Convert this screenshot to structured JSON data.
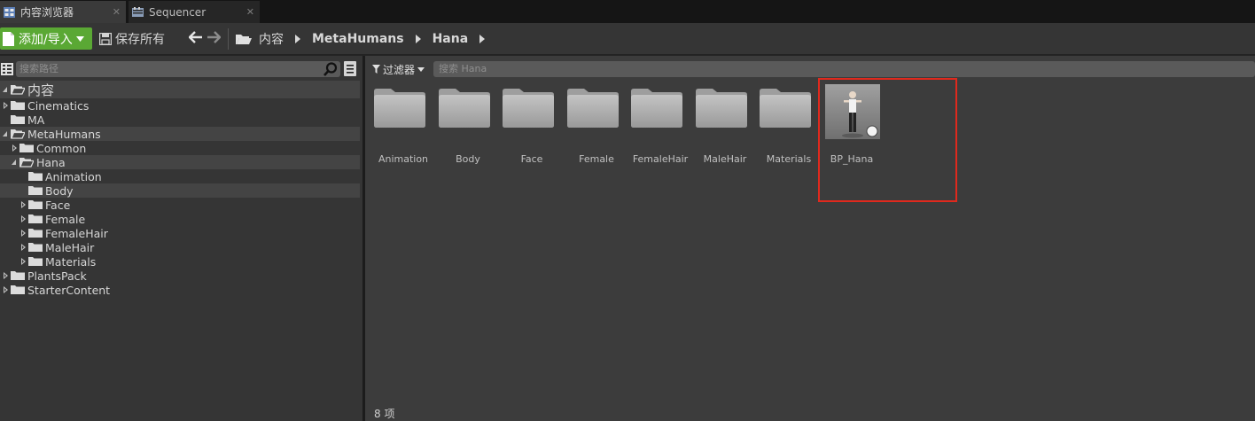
{
  "tabs": [
    {
      "label": "内容浏览器",
      "active": true,
      "close": "✕"
    },
    {
      "label": "Sequencer",
      "active": false,
      "close": "✕"
    }
  ],
  "toolbar": {
    "add_import_label": "添加/导入",
    "save_all_label": "保存所有",
    "breadcrumb": [
      "内容",
      "MetaHumans",
      "Hana"
    ]
  },
  "left_panel": {
    "search_placeholder": "搜索路径",
    "tree": [
      {
        "label": "内容",
        "expander": "open",
        "highlight": true,
        "root": true,
        "indent": 0
      },
      {
        "label": "Cinematics",
        "expander": "closed",
        "highlight": false,
        "indent": 1
      },
      {
        "label": "MA",
        "expander": "none",
        "highlight": false,
        "indent": 1
      },
      {
        "label": "MetaHumans",
        "expander": "open",
        "highlight": true,
        "indent": 1
      },
      {
        "label": "Common",
        "expander": "closed",
        "highlight": false,
        "indent": 2
      },
      {
        "label": "Hana",
        "expander": "open",
        "highlight": true,
        "indent": 2
      },
      {
        "label": "Animation",
        "expander": "none",
        "highlight": false,
        "indent": 3
      },
      {
        "label": "Body",
        "expander": "none",
        "highlight": true,
        "indent": 3
      },
      {
        "label": "Face",
        "expander": "closed",
        "highlight": false,
        "indent": 3
      },
      {
        "label": "Female",
        "expander": "closed",
        "highlight": false,
        "indent": 3
      },
      {
        "label": "FemaleHair",
        "expander": "closed",
        "highlight": false,
        "indent": 3
      },
      {
        "label": "MaleHair",
        "expander": "closed",
        "highlight": false,
        "indent": 3
      },
      {
        "label": "Materials",
        "expander": "closed",
        "highlight": false,
        "indent": 3
      },
      {
        "label": "PlantsPack",
        "expander": "closed",
        "highlight": false,
        "indent": 1
      },
      {
        "label": "StarterContent",
        "expander": "closed",
        "highlight": false,
        "indent": 1
      }
    ]
  },
  "right_panel": {
    "filter_label": "过滤器",
    "search_placeholder": "搜索 Hana",
    "assets": [
      {
        "label": "Animation",
        "kind": "folder"
      },
      {
        "label": "Body",
        "kind": "folder"
      },
      {
        "label": "Face",
        "kind": "folder"
      },
      {
        "label": "Female",
        "kind": "folder"
      },
      {
        "label": "FemaleHair",
        "kind": "folder"
      },
      {
        "label": "MaleHair",
        "kind": "folder"
      },
      {
        "label": "Materials",
        "kind": "folder"
      },
      {
        "label": "BP_Hana",
        "kind": "blueprint"
      }
    ],
    "item_count": "8 项"
  },
  "colors": {
    "accent_green": "#5aa834",
    "selection_outline": "#e0291d",
    "thumbnail_underline": "#3b7bd8"
  }
}
